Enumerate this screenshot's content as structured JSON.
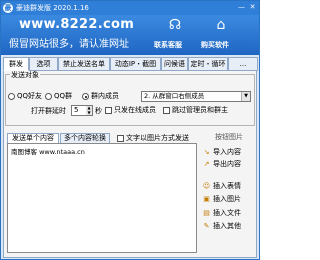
{
  "window": {
    "title": "豪迪群发版 2020.1.16",
    "min_glyph": "—",
    "close_glyph": "✕"
  },
  "banner": {
    "url": "www.8222.com",
    "slogan": "假冒网站很多，请认准网址",
    "contact_label": "联系客服",
    "buy_label": "购买软件",
    "contact_icon": "headset-icon",
    "buy_icon": "house-icon"
  },
  "tabs": [
    {
      "label": "群发",
      "active": true
    },
    {
      "label": "选项",
      "active": false
    },
    {
      "label": "禁止发送名单",
      "active": false
    },
    {
      "label": "动态IP・截图",
      "active": false
    },
    {
      "label": "问候语",
      "active": false
    },
    {
      "label": "定时・循环",
      "active": false
    },
    {
      "label": "...",
      "active": false
    }
  ],
  "send_target": {
    "group_title": "发送对象",
    "options": [
      {
        "label": "QQ好友",
        "checked": false
      },
      {
        "label": "QQ群",
        "checked": false
      },
      {
        "label": "群内成员",
        "checked": true
      }
    ],
    "select_value": "2. 从群窗口右侧成员",
    "interval_label": "打开群延时",
    "interval_value": "5",
    "interval_unit": "秒",
    "only_online_label": "只发在线成员",
    "skip_admin_label": "跳过管理员和群主"
  },
  "content": {
    "tabs": [
      {
        "label": "发送单个内容",
        "active": true
      },
      {
        "label": "多个内容轮换",
        "active": false
      }
    ],
    "image_mode_label": "文字以图片方式发送",
    "text": "南图博客 www.ntaaa.cn"
  },
  "side": {
    "title": "按钮图片",
    "buttons": [
      {
        "label": "导入内容",
        "icon": "import-icon"
      },
      {
        "label": "导出内容",
        "icon": "export-icon"
      },
      {
        "label": "插入表情",
        "icon": "smiley-icon"
      },
      {
        "label": "插入图片",
        "icon": "image-icon"
      },
      {
        "label": "插入文件",
        "icon": "file-icon"
      },
      {
        "label": "插入其他",
        "icon": "more-icon"
      }
    ]
  }
}
